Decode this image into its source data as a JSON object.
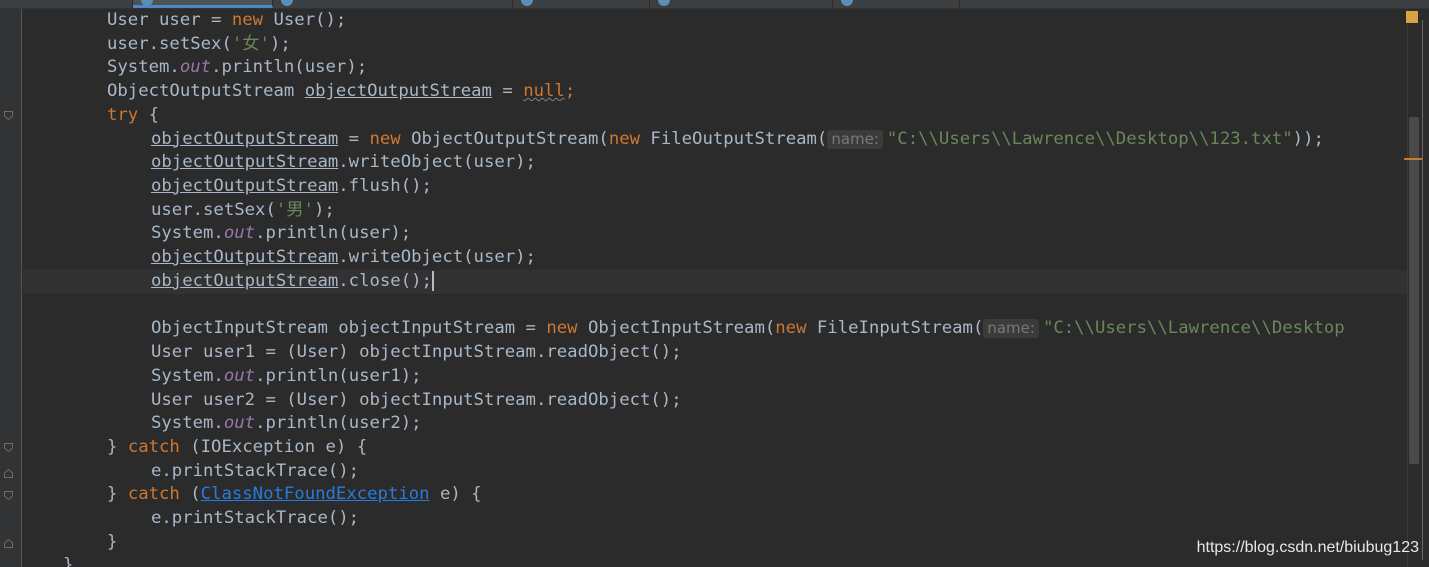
{
  "tabs": [
    {
      "label": "",
      "active": false
    },
    {
      "label": "",
      "active": true
    },
    {
      "label": "",
      "active": false
    },
    {
      "label": "",
      "active": false
    },
    {
      "label": "",
      "active": false
    },
    {
      "label": "",
      "active": false
    },
    {
      "label": "",
      "active": false
    }
  ],
  "hints": {
    "name_label": "name:"
  },
  "code": {
    "l1_a": "User user = ",
    "l1_new": "new",
    "l1_b": " User();",
    "l2_a": "user.setSex(",
    "l2_str": "'女'",
    "l2_b": ");",
    "l3_a": "System.",
    "l3_out": "out",
    "l3_b": ".println(user);",
    "l4_a": "ObjectOutputStream ",
    "l4_var": "objectOutputStream",
    "l4_b": " = ",
    "l4_null": "null",
    "l4_semi": ";",
    "l5_try": "try",
    "l5_b": " {",
    "l6_var": "objectOutputStream",
    "l6_a": " = ",
    "l6_new1": "new",
    "l6_b": " ObjectOutputStream(",
    "l6_new2": "new",
    "l6_c": " FileOutputStream(",
    "l6_str": "\"C:\\\\Users\\\\Lawrence\\\\Desktop\\\\123.txt\"",
    "l6_d": "));",
    "l7_var": "objectOutputStream",
    "l7_a": ".writeObject(user);",
    "l8_var": "objectOutputStream",
    "l8_a": ".flush();",
    "l9_a": "user.setSex(",
    "l9_str": "'男'",
    "l9_b": ");",
    "l10_a": "System.",
    "l10_out": "out",
    "l10_b": ".println(user);",
    "l11_var": "objectOutputStream",
    "l11_a": ".writeObject(user);",
    "l12_var": "objectOutputStream",
    "l12_a": ".close();",
    "l14_a": "ObjectInputStream objectInputStream = ",
    "l14_new1": "new",
    "l14_b": " ObjectInputStream(",
    "l14_new2": "new",
    "l14_c": " FileInputStream(",
    "l14_str": "\"C:\\\\Users\\\\Lawrence\\\\Desktop",
    "l15_a": "User user1 = (User) objectInputStream.readObject();",
    "l16_a": "System.",
    "l16_out": "out",
    "l16_b": ".println(user1);",
    "l17_a": "User user2 = (User) objectInputStream.readObject();",
    "l18_a": "System.",
    "l18_out": "out",
    "l18_b": ".println(user2);",
    "l19_a": "} ",
    "l19_catch": "catch",
    "l19_b": " (IOException e) {",
    "l20_a": "e.printStackTrace();",
    "l21_a": "} ",
    "l21_catch": "catch",
    "l21_b": " (",
    "l21_link": "ClassNotFoundException",
    "l21_c": " e) {",
    "l22_a": "e.printStackTrace();",
    "l23_a": "}",
    "l24_a": "}"
  },
  "watermark": "https://blog.csdn.net/biubug123",
  "colors": {
    "background": "#2b2b2b",
    "keyword": "#cc7832",
    "string": "#6a8759",
    "field": "#9876aa",
    "default_text": "#a9b7c6",
    "link": "#287bde",
    "hint_bg": "#3b3b3b",
    "hint_text": "#787878"
  }
}
